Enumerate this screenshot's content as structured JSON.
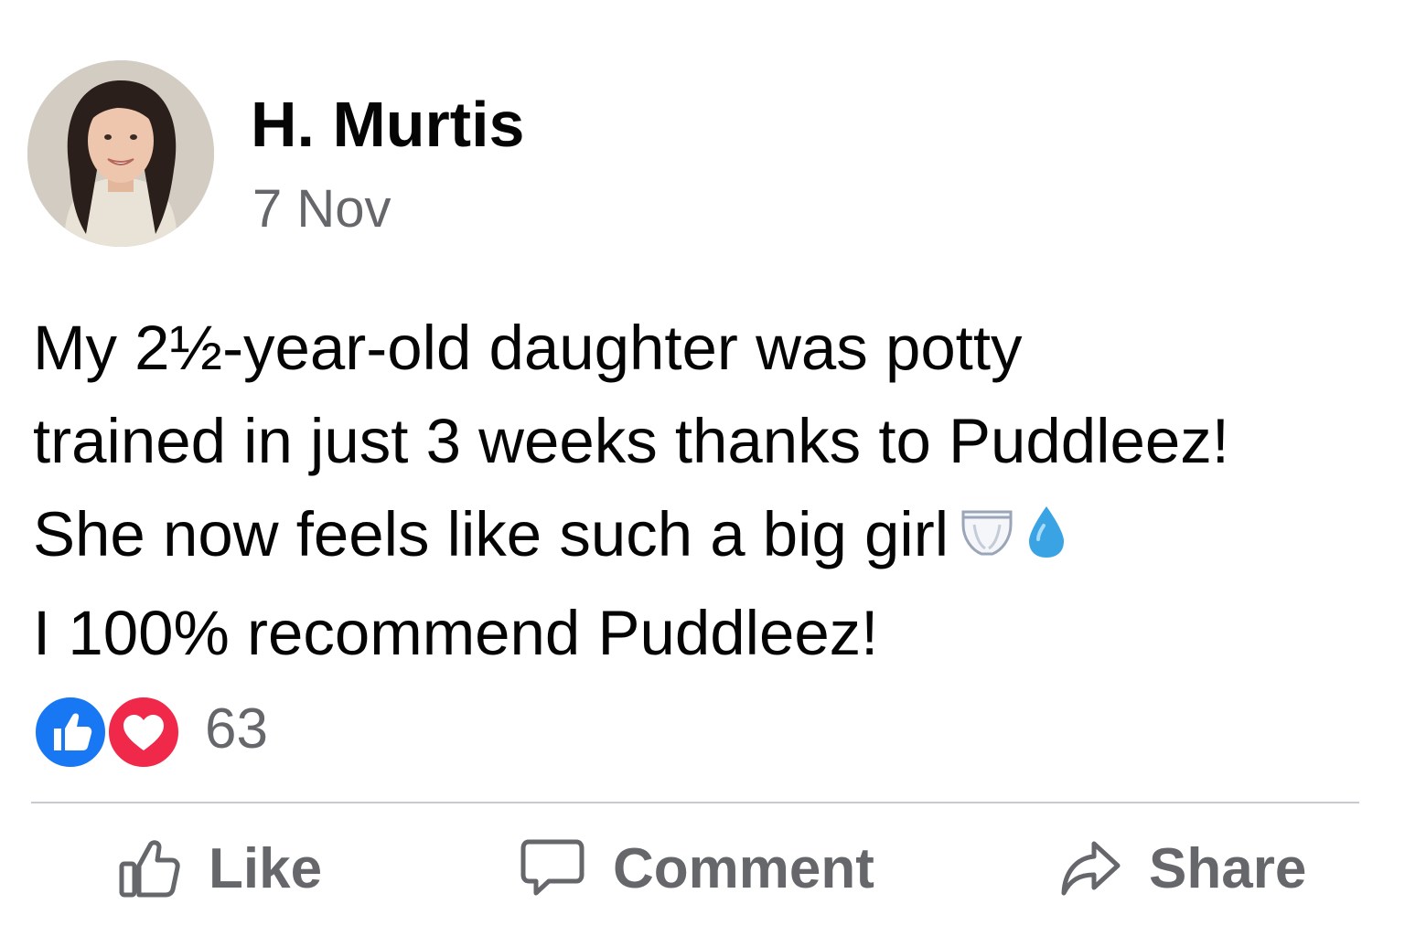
{
  "post": {
    "author": "H. Murtis",
    "date": "7 Nov",
    "avatar_icon": "avatar-photo",
    "body_lines": [
      "My 2½-year-old daughter was potty",
      "trained in just 3 weeks thanks to Puddleez!",
      "She now feels like such a big girl",
      "I 100% recommend Puddleez!"
    ],
    "emojis": [
      "underwear-icon",
      "droplet-icon"
    ]
  },
  "reactions": {
    "types": [
      "like-icon",
      "love-icon"
    ],
    "count": "63"
  },
  "actions": {
    "like_label": "Like",
    "comment_label": "Comment",
    "share_label": "Share"
  },
  "colors": {
    "like_blue": "#1877f2",
    "love_red": "#f02849",
    "secondary_text": "#65676b",
    "primary_text": "#050505",
    "droplet": "#3aa3e3"
  }
}
